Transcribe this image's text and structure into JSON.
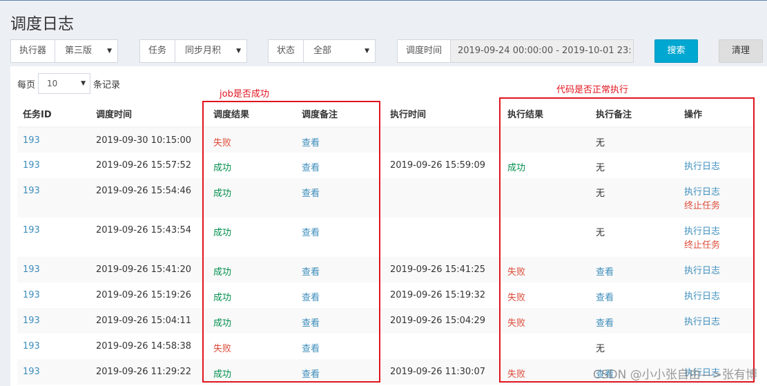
{
  "page": {
    "title": "调度日志"
  },
  "filters": {
    "executor": {
      "label": "执行器",
      "value": "第三版"
    },
    "task": {
      "label": "任务",
      "value": "同步月积"
    },
    "status": {
      "label": "状态",
      "value": "全部"
    },
    "time": {
      "label": "调度时间",
      "value": "2019-09-24 00:00:00 - 2019-10-01 23:"
    },
    "search_label": "搜索",
    "clear_label": "清理"
  },
  "perpage": {
    "prefix": "每页",
    "value": "10",
    "suffix": "条记录"
  },
  "annotations": {
    "left": "job是否成功",
    "right": "代码是否正常执行"
  },
  "table": {
    "headers": [
      "任务ID",
      "调度时间",
      "调度结果",
      "调度备注",
      "执行时间",
      "执行结果",
      "执行备注",
      "操作"
    ],
    "rows": [
      {
        "id": "193",
        "trigger_time": "2019-09-30 10:15:00",
        "trigger_result": "失败",
        "trigger_note": "查看",
        "exec_time": "",
        "exec_result": "",
        "exec_note": "无",
        "actions": []
      },
      {
        "id": "193",
        "trigger_time": "2019-09-26 15:57:52",
        "trigger_result": "成功",
        "trigger_note": "查看",
        "exec_time": "2019-09-26 15:59:09",
        "exec_result": "成功",
        "exec_note": "无",
        "actions": [
          "执行日志"
        ]
      },
      {
        "id": "193",
        "trigger_time": "2019-09-26 15:54:46",
        "trigger_result": "成功",
        "trigger_note": "查看",
        "exec_time": "",
        "exec_result": "",
        "exec_note": "无",
        "actions": [
          "执行日志",
          "终止任务"
        ]
      },
      {
        "id": "193",
        "trigger_time": "2019-09-26 15:43:54",
        "trigger_result": "成功",
        "trigger_note": "查看",
        "exec_time": "",
        "exec_result": "",
        "exec_note": "无",
        "actions": [
          "执行日志",
          "终止任务"
        ]
      },
      {
        "id": "193",
        "trigger_time": "2019-09-26 15:41:20",
        "trigger_result": "成功",
        "trigger_note": "查看",
        "exec_time": "2019-09-26 15:41:25",
        "exec_result": "失败",
        "exec_note": "查看",
        "actions": [
          "执行日志"
        ]
      },
      {
        "id": "193",
        "trigger_time": "2019-09-26 15:19:26",
        "trigger_result": "成功",
        "trigger_note": "查看",
        "exec_time": "2019-09-26 15:19:32",
        "exec_result": "失败",
        "exec_note": "查看",
        "actions": [
          "执行日志"
        ]
      },
      {
        "id": "193",
        "trigger_time": "2019-09-26 15:04:11",
        "trigger_result": "成功",
        "trigger_note": "查看",
        "exec_time": "2019-09-26 15:04:29",
        "exec_result": "失败",
        "exec_note": "查看",
        "actions": [
          "执行日志"
        ]
      },
      {
        "id": "193",
        "trigger_time": "2019-09-26 14:58:38",
        "trigger_result": "失败",
        "trigger_note": "查看",
        "exec_time": "",
        "exec_result": "",
        "exec_note": "无",
        "actions": []
      },
      {
        "id": "193",
        "trigger_time": "2019-09-26 11:29:22",
        "trigger_result": "成功",
        "trigger_note": "查看",
        "exec_time": "2019-09-26 11:30:07",
        "exec_result": "失败",
        "exec_note": "查看",
        "actions": [
          "执行日志"
        ]
      }
    ]
  },
  "watermark": "CSDN @小小张自由—>张有博",
  "colors": {
    "accent": "#3c8dbc",
    "success": "#008d4c",
    "fail": "#dd4b39",
    "annotation": "#e0141e",
    "search_button": "#00a7d0"
  }
}
